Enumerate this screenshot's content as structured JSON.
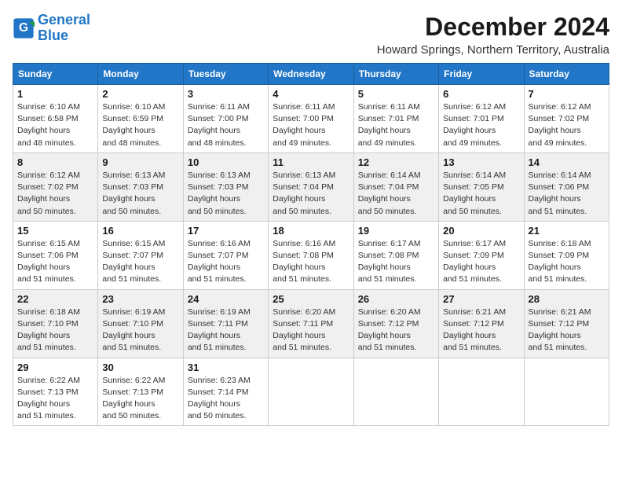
{
  "logo": {
    "line1": "General",
    "line2": "Blue"
  },
  "title": "December 2024",
  "subtitle": "Howard Springs, Northern Territory, Australia",
  "days_of_week": [
    "Sunday",
    "Monday",
    "Tuesday",
    "Wednesday",
    "Thursday",
    "Friday",
    "Saturday"
  ],
  "weeks": [
    [
      {
        "day": "1",
        "sunrise": "6:10 AM",
        "sunset": "6:58 PM",
        "daylight": "12 hours and 48 minutes."
      },
      {
        "day": "2",
        "sunrise": "6:10 AM",
        "sunset": "6:59 PM",
        "daylight": "12 hours and 48 minutes."
      },
      {
        "day": "3",
        "sunrise": "6:11 AM",
        "sunset": "7:00 PM",
        "daylight": "12 hours and 48 minutes."
      },
      {
        "day": "4",
        "sunrise": "6:11 AM",
        "sunset": "7:00 PM",
        "daylight": "12 hours and 49 minutes."
      },
      {
        "day": "5",
        "sunrise": "6:11 AM",
        "sunset": "7:01 PM",
        "daylight": "12 hours and 49 minutes."
      },
      {
        "day": "6",
        "sunrise": "6:12 AM",
        "sunset": "7:01 PM",
        "daylight": "12 hours and 49 minutes."
      },
      {
        "day": "7",
        "sunrise": "6:12 AM",
        "sunset": "7:02 PM",
        "daylight": "12 hours and 49 minutes."
      }
    ],
    [
      {
        "day": "8",
        "sunrise": "6:12 AM",
        "sunset": "7:02 PM",
        "daylight": "12 hours and 50 minutes."
      },
      {
        "day": "9",
        "sunrise": "6:13 AM",
        "sunset": "7:03 PM",
        "daylight": "12 hours and 50 minutes."
      },
      {
        "day": "10",
        "sunrise": "6:13 AM",
        "sunset": "7:03 PM",
        "daylight": "12 hours and 50 minutes."
      },
      {
        "day": "11",
        "sunrise": "6:13 AM",
        "sunset": "7:04 PM",
        "daylight": "12 hours and 50 minutes."
      },
      {
        "day": "12",
        "sunrise": "6:14 AM",
        "sunset": "7:04 PM",
        "daylight": "12 hours and 50 minutes."
      },
      {
        "day": "13",
        "sunrise": "6:14 AM",
        "sunset": "7:05 PM",
        "daylight": "12 hours and 50 minutes."
      },
      {
        "day": "14",
        "sunrise": "6:14 AM",
        "sunset": "7:06 PM",
        "daylight": "12 hours and 51 minutes."
      }
    ],
    [
      {
        "day": "15",
        "sunrise": "6:15 AM",
        "sunset": "7:06 PM",
        "daylight": "12 hours and 51 minutes."
      },
      {
        "day": "16",
        "sunrise": "6:15 AM",
        "sunset": "7:07 PM",
        "daylight": "12 hours and 51 minutes."
      },
      {
        "day": "17",
        "sunrise": "6:16 AM",
        "sunset": "7:07 PM",
        "daylight": "12 hours and 51 minutes."
      },
      {
        "day": "18",
        "sunrise": "6:16 AM",
        "sunset": "7:08 PM",
        "daylight": "12 hours and 51 minutes."
      },
      {
        "day": "19",
        "sunrise": "6:17 AM",
        "sunset": "7:08 PM",
        "daylight": "12 hours and 51 minutes."
      },
      {
        "day": "20",
        "sunrise": "6:17 AM",
        "sunset": "7:09 PM",
        "daylight": "12 hours and 51 minutes."
      },
      {
        "day": "21",
        "sunrise": "6:18 AM",
        "sunset": "7:09 PM",
        "daylight": "12 hours and 51 minutes."
      }
    ],
    [
      {
        "day": "22",
        "sunrise": "6:18 AM",
        "sunset": "7:10 PM",
        "daylight": "12 hours and 51 minutes."
      },
      {
        "day": "23",
        "sunrise": "6:19 AM",
        "sunset": "7:10 PM",
        "daylight": "12 hours and 51 minutes."
      },
      {
        "day": "24",
        "sunrise": "6:19 AM",
        "sunset": "7:11 PM",
        "daylight": "12 hours and 51 minutes."
      },
      {
        "day": "25",
        "sunrise": "6:20 AM",
        "sunset": "7:11 PM",
        "daylight": "12 hours and 51 minutes."
      },
      {
        "day": "26",
        "sunrise": "6:20 AM",
        "sunset": "7:12 PM",
        "daylight": "12 hours and 51 minutes."
      },
      {
        "day": "27",
        "sunrise": "6:21 AM",
        "sunset": "7:12 PM",
        "daylight": "12 hours and 51 minutes."
      },
      {
        "day": "28",
        "sunrise": "6:21 AM",
        "sunset": "7:12 PM",
        "daylight": "12 hours and 51 minutes."
      }
    ],
    [
      {
        "day": "29",
        "sunrise": "6:22 AM",
        "sunset": "7:13 PM",
        "daylight": "12 hours and 51 minutes."
      },
      {
        "day": "30",
        "sunrise": "6:22 AM",
        "sunset": "7:13 PM",
        "daylight": "12 hours and 50 minutes."
      },
      {
        "day": "31",
        "sunrise": "6:23 AM",
        "sunset": "7:14 PM",
        "daylight": "12 hours and 50 minutes."
      },
      null,
      null,
      null,
      null
    ]
  ]
}
